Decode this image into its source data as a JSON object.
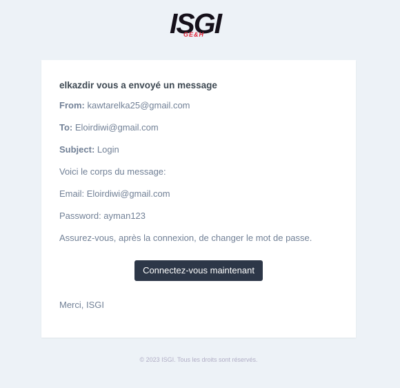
{
  "header": {
    "logo_text": "ISGI",
    "logo_subtext": "GE&H"
  },
  "email": {
    "heading": "elkazdir vous a envoyé un message",
    "from_label": "From:",
    "from_value": "kawtarelka25@gmail.com",
    "to_label": "To:",
    "to_value": "Eloirdiwi@gmail.com",
    "subject_label": "Subject:",
    "subject_value": "Login",
    "body_intro": "Voici le corps du message:",
    "email_line": "Email: Eloirdiwi@gmail.com",
    "password_line": "Password: ayman123",
    "advice": "Assurez-vous, après la connexion, de changer le mot de passe.",
    "button_label": "Connectez-vous maintenant",
    "signoff": "Merci, ISGI"
  },
  "footer": {
    "copyright": "© 2023 ISGI. Tous les droits sont réservés."
  }
}
